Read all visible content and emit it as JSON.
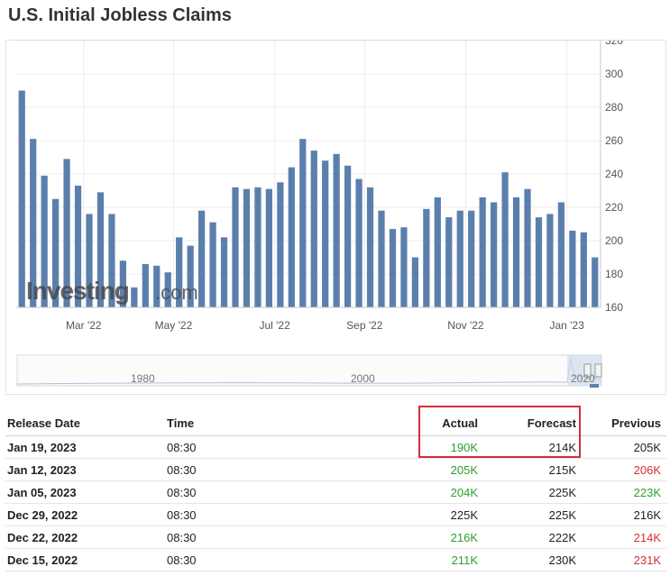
{
  "title": "U.S. Initial Jobless Claims",
  "watermark": {
    "main": "Investing",
    "suffix": ".com"
  },
  "navigator": {
    "labels": [
      "1980",
      "2000",
      "2020"
    ]
  },
  "colors": {
    "bar": "#5b7fad",
    "grid": "#ececec",
    "positive": "#2e9e2e",
    "negative": "#d32f2f",
    "highlight": "#d22f3c"
  },
  "chart_data": {
    "type": "bar",
    "title": "U.S. Initial Jobless Claims",
    "xlabel": "",
    "ylabel": "",
    "ylim": [
      160,
      320
    ],
    "yticks": [
      160,
      180,
      200,
      220,
      240,
      260,
      280,
      300,
      320
    ],
    "y_axis_side": "right",
    "grid": true,
    "x_tick_labels": [
      {
        "label": "Mar '22",
        "index": 5.5
      },
      {
        "label": "May '22",
        "index": 13.5
      },
      {
        "label": "Jul '22",
        "index": 22.5
      },
      {
        "label": "Sep '22",
        "index": 30.5
      },
      {
        "label": "Nov '22",
        "index": 39.5
      },
      {
        "label": "Jan '23",
        "index": 48.5
      }
    ],
    "values": [
      290,
      261,
      239,
      225,
      249,
      233,
      216,
      229,
      216,
      188,
      172,
      186,
      185,
      181,
      202,
      197,
      218,
      211,
      202,
      232,
      231,
      232,
      231,
      235,
      244,
      261,
      254,
      248,
      252,
      245,
      237,
      232,
      218,
      207,
      208,
      190,
      219,
      226,
      214,
      218,
      218,
      226,
      223,
      241,
      226,
      231,
      214,
      216,
      223,
      206,
      205,
      190
    ]
  },
  "table": {
    "headers": {
      "date": "Release Date",
      "time": "Time",
      "actual": "Actual",
      "forecast": "Forecast",
      "previous": "Previous"
    },
    "rows": [
      {
        "date": "Jan 19, 2023",
        "time": "08:30",
        "actual": "190K",
        "actual_status": "up",
        "forecast": "214K",
        "previous": "205K",
        "previous_status": ""
      },
      {
        "date": "Jan 12, 2023",
        "time": "08:30",
        "actual": "205K",
        "actual_status": "up",
        "forecast": "215K",
        "previous": "206K",
        "previous_status": "down"
      },
      {
        "date": "Jan 05, 2023",
        "time": "08:30",
        "actual": "204K",
        "actual_status": "up",
        "forecast": "225K",
        "previous": "223K",
        "previous_status": "up"
      },
      {
        "date": "Dec 29, 2022",
        "time": "08:30",
        "actual": "225K",
        "actual_status": "",
        "forecast": "225K",
        "previous": "216K",
        "previous_status": ""
      },
      {
        "date": "Dec 22, 2022",
        "time": "08:30",
        "actual": "216K",
        "actual_status": "up",
        "forecast": "222K",
        "previous": "214K",
        "previous_status": "down"
      },
      {
        "date": "Dec 15, 2022",
        "time": "08:30",
        "actual": "211K",
        "actual_status": "up",
        "forecast": "230K",
        "previous": "231K",
        "previous_status": "down"
      }
    ]
  }
}
